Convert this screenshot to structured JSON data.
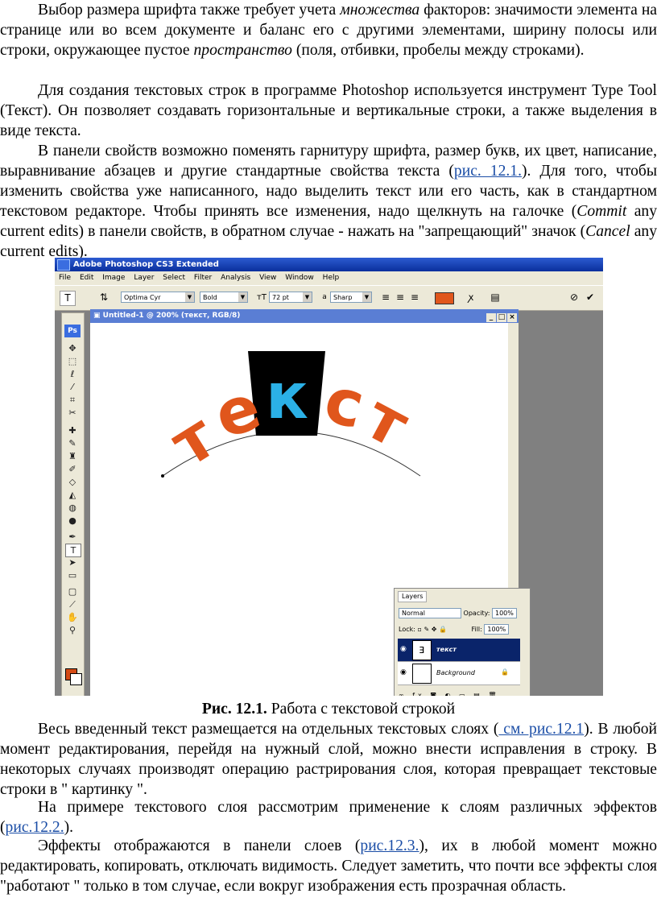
{
  "paragraphs": {
    "p1": {
      "a": "Выбор размера шрифта также требует учета ",
      "b_italic": "множества",
      "c": " факторов: значимости элемента на странице или во всем документе и баланс его с другими элементами, ширину полосы или строки, окружающее пустое ",
      "d_italic": "пространство",
      "e": " (поля, отбивки, пробелы между строками)."
    },
    "p2": "Для создания текстовых строк в программе Photoshop используется инструмент Type Tool (Текст). Он позволяет создавать горизонтальные и вертикальные строки, а также выделения в виде текста.",
    "p3": {
      "a": "В панели свойств возможно поменять гарнитуру шрифта, размер букв, их цвет, написание, выравнивание абзацев и другие стандартные свойства текста (",
      "link": "рис. 12.1.",
      "b": "). Для того, чтобы изменить свойства уже написанного, надо выделить текст или его часть, как в стандартном текстовом редакторе. Чтобы принять все изменения, надо щелкнуть на галочке (",
      "commit_italic": "Commit",
      "c": " any current edits) в панели свойств, в обратном случае - нажать на \"запрещающий\" значок (",
      "cancel_italic": "Cancel",
      "d": " any current edits)."
    },
    "p4": {
      "a": "Весь введенный текст размещается на отдельных текстовых слоях (",
      "link": " см. рис.12.1",
      "b": "). В любой момент редактирования, перейдя на нужный слой, можно внести исправления в строку. В некоторых случаях производят операцию растрирования слоя, которая превращает текстовые строки в \" картинку \"."
    },
    "p5": {
      "a": "На примере текстового слоя рассмотрим применение к слоям различных эффектов (",
      "link": "рис.12.2.",
      "b": ")."
    },
    "p6": {
      "a": "Эффекты отображаются в панели слоев (",
      "link": "рис.12.3.",
      "b": "), их в любой момент можно редактировать, копировать, отключать видимость. Следует заметить, что почти все эффекты слоя \"работают \" только в том случае, если вокруг изображения есть прозрачная область."
    }
  },
  "caption": {
    "bold": "Рис. 12.1.",
    "text": " Работа с текстовой строкой"
  },
  "photoshop": {
    "app_title": "Adobe Photoshop CS3 Extended",
    "menu": [
      "File",
      "Edit",
      "Image",
      "Layer",
      "Select",
      "Filter",
      "Analysis",
      "View",
      "Window",
      "Help"
    ],
    "font_family": "Optima Cyr",
    "font_style": "Bold",
    "font_size": "72 pt",
    "antialias_label": "a",
    "antialias": "Sharp",
    "doc_title": "Untitled-1 @ 200% (текст, RGB/8)",
    "canvas_text": [
      "т",
      "е",
      "к",
      "с",
      "т"
    ],
    "text_color": "#e0561c",
    "highlight_color": "#2bb0e6",
    "layers_panel": {
      "tab": "Layers",
      "blend_mode": "Normal",
      "opacity_label": "Opacity:",
      "opacity": "100%",
      "lock_label": "Lock:",
      "fill_label": "Fill:",
      "fill": "100%",
      "layers": [
        {
          "name": "текст",
          "selected": true
        },
        {
          "name": "Background",
          "selected": false
        }
      ]
    },
    "ps_logo": "Ps"
  }
}
